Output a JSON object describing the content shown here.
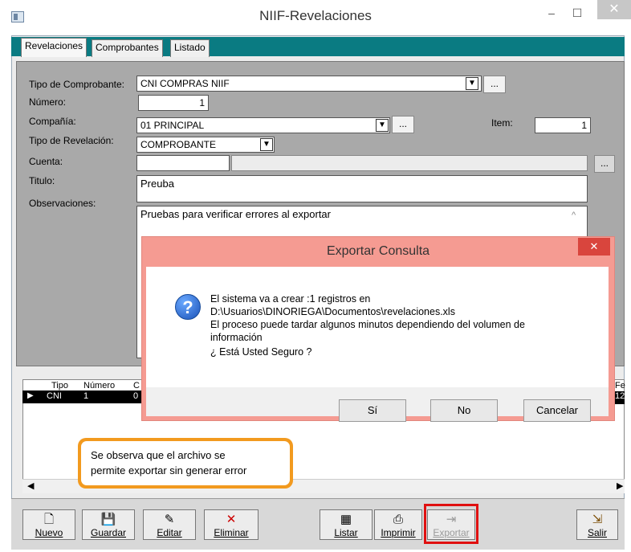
{
  "window": {
    "title": "NIIF-Revelaciones",
    "min": "–",
    "max": "☐",
    "close": "✕"
  },
  "tabs": [
    "Revelaciones",
    "Comprobantes",
    "Listado"
  ],
  "form": {
    "tipo_comprobante_label": "Tipo de Comprobante:",
    "tipo_comprobante_value": "CNI COMPRAS NIIF",
    "numero_label": "Número:",
    "numero_value": "1",
    "compania_label": "Compañía:",
    "compania_value": "01 PRINCIPAL",
    "item_label": "Item:",
    "item_value": "1",
    "tipo_revelacion_label": "Tipo de Revelación:",
    "tipo_revelacion_value": "COMPROBANTE",
    "cuenta_label": "Cuenta:",
    "cuenta_value": "",
    "titulo_label": "Titulo:",
    "titulo_value": "Preuba",
    "observaciones_label": "Observaciones:",
    "observaciones_value": "Pruebas para verificar errores al exportar",
    "ellipsis": "..."
  },
  "grid": {
    "headers": [
      "Tipo",
      "Número",
      "C",
      "Fe"
    ],
    "row": [
      "CNI",
      "1",
      "0",
      "12/"
    ]
  },
  "dialog": {
    "title": "Exportar Consulta",
    "close": "✕",
    "icon": "?",
    "line1": "El sistema va a crear :1 registros en",
    "line2": "D:\\Usuarios\\DINORIEGA\\Documentos\\revelaciones.xls",
    "line3": "El proceso puede tardar algunos minutos dependiendo del volumen de",
    "line4": "información",
    "line5": "¿ Está Usted Seguro ?",
    "yes": "Sí",
    "no": "No",
    "cancel": "Cancelar"
  },
  "callout": {
    "line1": "Se observa que el archivo se",
    "line2": "permite exportar sin generar error"
  },
  "toolbar": {
    "nuevo": "Nuevo",
    "guardar": "Guardar",
    "editar": "Editar",
    "eliminar": "Eliminar",
    "listar": "Listar",
    "imprimir": "Imprimir",
    "exportar": "Exportar",
    "salir": "Salir"
  },
  "icons": {
    "dropdown": "▼",
    "scroll_left": "◀",
    "scroll_right": "▶",
    "row_pointer": "▶",
    "scroll_up": "^"
  }
}
